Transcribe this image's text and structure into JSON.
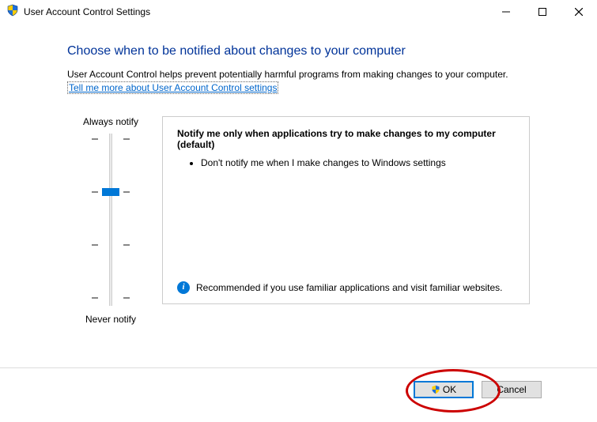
{
  "window": {
    "title": "User Account Control Settings"
  },
  "header": {
    "heading": "Choose when to be notified about changes to your computer",
    "body": "User Account Control helps prevent potentially harmful programs from making changes to your computer.",
    "link": "Tell me more about User Account Control settings"
  },
  "slider": {
    "top_label": "Always notify",
    "bottom_label": "Never notify",
    "levels": 4,
    "current_level": 2
  },
  "description": {
    "title": "Notify me only when applications try to make changes to my computer (default)",
    "bullets": [
      "Don't notify me when I make changes to Windows settings"
    ],
    "recommendation": "Recommended if you use familiar applications and visit familiar websites."
  },
  "footer": {
    "ok": "OK",
    "cancel": "Cancel"
  }
}
